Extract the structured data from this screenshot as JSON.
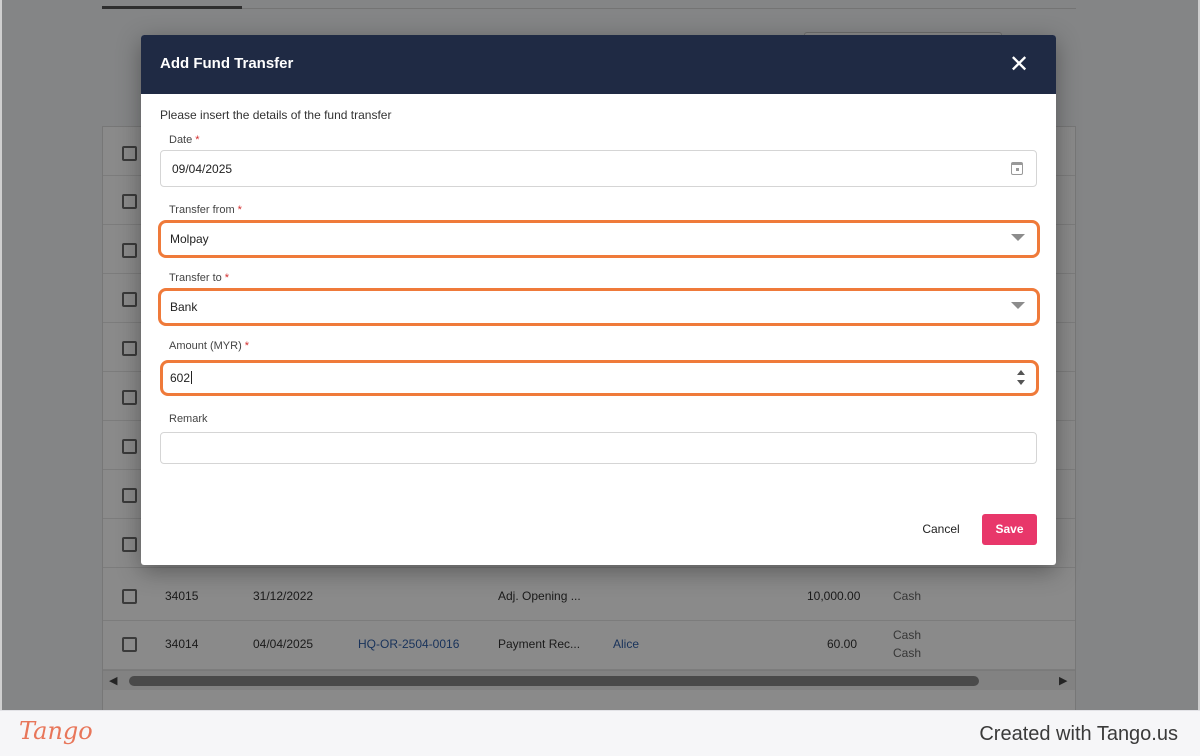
{
  "modal": {
    "title": "Add Fund Transfer",
    "close_icon": "close-icon",
    "subtitle": "Please insert the details of the fund transfer",
    "fields": {
      "date": {
        "label": "Date",
        "required_mark": "*",
        "value": "09/04/2025",
        "icon": "calendar-icon"
      },
      "transfer_from": {
        "label": "Transfer from",
        "required_mark": "*",
        "value": "Molpay",
        "icon": "chevron-down-icon"
      },
      "transfer_to": {
        "label": "Transfer to",
        "required_mark": "*",
        "value": "Bank",
        "icon": "chevron-down-icon"
      },
      "amount": {
        "label": "Amount (MYR)",
        "required_mark": "*",
        "value": "602",
        "icon": "stepper-icon"
      },
      "remark": {
        "label": "Remark",
        "value": ""
      }
    },
    "cancel_label": "Cancel",
    "save_label": "Save",
    "highlight_color": "#ef7a3a",
    "save_color": "#e8376a",
    "header_color": "#1f2a44"
  },
  "background_table": {
    "rows": [
      {
        "id": "34015",
        "date": "31/12/2022",
        "ref": "",
        "description": "Adj. Opening ...",
        "contact": "",
        "amount": "10,000.00",
        "method": [
          "Cash"
        ]
      },
      {
        "id": "34014",
        "date": "04/04/2025",
        "ref": "HQ-OR-2504-0016",
        "description": "Payment Rec...",
        "contact": "Alice",
        "amount": "60.00",
        "method": [
          "Cash",
          "Cash"
        ]
      }
    ]
  },
  "footer": {
    "logo": "Tango",
    "created_with": "Created with Tango.us"
  }
}
